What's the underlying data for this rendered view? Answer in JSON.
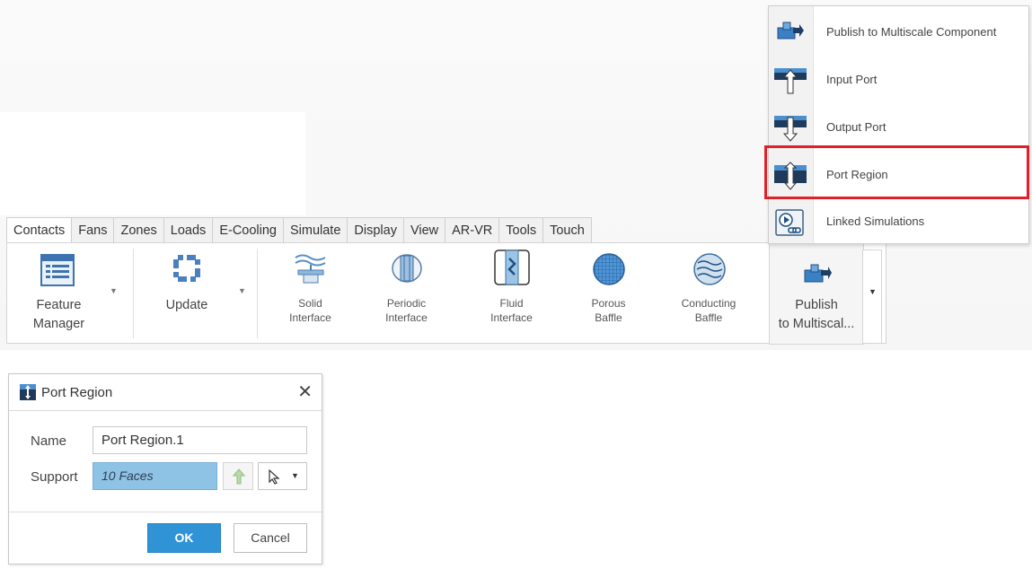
{
  "tabs": [
    "Contacts",
    "Fans",
    "Zones",
    "Loads",
    "E-Cooling",
    "Simulate",
    "Display",
    "View",
    "AR-VR",
    "Tools",
    "Touch"
  ],
  "active_tab": "Contacts",
  "ribbon": {
    "feature_manager": [
      "Feature",
      "Manager"
    ],
    "update": "Update",
    "solid_interface": [
      "Solid",
      "Interface"
    ],
    "periodic_interface": [
      "Periodic",
      "Interface"
    ],
    "fluid_interface": [
      "Fluid",
      "Interface"
    ],
    "porous_baffle": [
      "Porous",
      "Baffle"
    ],
    "conducting_baffle": [
      "Conducting",
      "Baffle"
    ],
    "publish": [
      "Publish",
      "to Multiscal..."
    ]
  },
  "menu": {
    "items": [
      {
        "label": "Publish to Multiscale Component",
        "icon": "publish-icon"
      },
      {
        "label": "Input Port",
        "icon": "input-port-icon"
      },
      {
        "label": "Output Port",
        "icon": "output-port-icon"
      },
      {
        "label": "Port Region",
        "icon": "port-region-icon"
      },
      {
        "label": "Linked Simulations",
        "icon": "linked-simulations-icon"
      }
    ],
    "highlighted_index": 3
  },
  "dialog": {
    "title": "Port Region",
    "name_label": "Name",
    "name_value": "Port Region.1",
    "support_label": "Support",
    "support_value": "10 Faces",
    "ok_label": "OK",
    "cancel_label": "Cancel"
  },
  "colors": {
    "highlight": "#e0202a",
    "ok_button": "#2f93d6",
    "support_field": "#8fc3e6"
  }
}
